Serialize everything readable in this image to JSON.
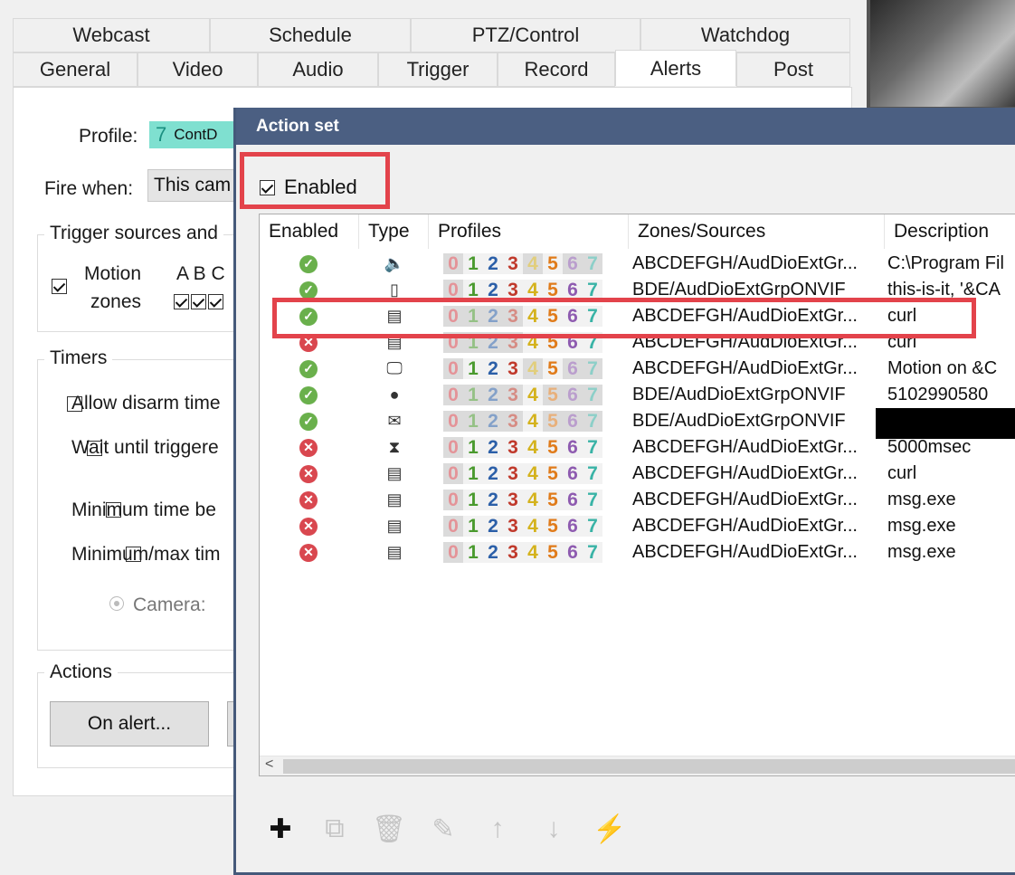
{
  "tabs_row1": [
    "Webcast",
    "Schedule",
    "PTZ/Control",
    "Watchdog"
  ],
  "tabs_row2": [
    "General",
    "Video",
    "Audio",
    "Trigger",
    "Record",
    "Alerts",
    "Post"
  ],
  "alerts_panel": {
    "profile_label": "Profile:",
    "profile_value_num": "7",
    "profile_value_text": "ContD",
    "fire_when_label": "Fire when:",
    "fire_when_value": "This cam",
    "trigger_group": "Trigger sources and",
    "motion_label_1": "Motion",
    "motion_label_2": "zones",
    "zone_letters": "A B C",
    "timers_group": "Timers",
    "allow_disarm": "Allow disarm time",
    "wait_until": "Wait until triggere",
    "minimum_time": "Minimum time be",
    "minmax_time": "Minimum/max tim",
    "camera_radio": "Camera:",
    "actions_group": "Actions",
    "on_alert_button": "On alert..."
  },
  "action_set": {
    "title": "Action set",
    "enabled_label": "Enabled",
    "enabled_checked": true,
    "columns": [
      "Enabled",
      "Type",
      "Profiles",
      "Zones/Sources",
      "Description"
    ],
    "profile_digits": [
      "0",
      "1",
      "2",
      "3",
      "4",
      "5",
      "6",
      "7"
    ],
    "profile_colors": [
      "#d9474f",
      "#4a9a2e",
      "#2b5fa8",
      "#c0392b",
      "#d4b21c",
      "#e07b1a",
      "#8e5bb0",
      "#39b3a6"
    ],
    "rows": [
      {
        "enabled": true,
        "type_icon": "speaker-icon",
        "type_glyph": "🔈",
        "profiles_on": [
          1,
          2,
          3,
          5
        ],
        "zones": "ABCDEFGH/AudDioExtGr...",
        "description": "C:\\Program Fil"
      },
      {
        "enabled": true,
        "type_icon": "phone-icon",
        "type_glyph": "▯",
        "profiles_on": [
          1,
          2,
          3,
          4,
          5,
          6,
          7
        ],
        "zones": "BDE/AudDioExtGrpONVIF",
        "description": "this-is-it, '&CA"
      },
      {
        "enabled": true,
        "type_icon": "document-icon",
        "type_glyph": "▤",
        "profiles_on": [
          4,
          5,
          6,
          7
        ],
        "zones": "ABCDEFGH/AudDioExtGr...",
        "description": "curl"
      },
      {
        "enabled": false,
        "type_icon": "document-icon",
        "type_glyph": "▤",
        "profiles_on": [
          4,
          5,
          6,
          7
        ],
        "zones": "ABCDEFGH/AudDioExtGr...",
        "description": "curl"
      },
      {
        "enabled": true,
        "type_icon": "monitor-icon",
        "type_glyph": "🖵",
        "profiles_on": [
          1,
          2,
          3,
          5
        ],
        "zones": "ABCDEFGH/AudDioExtGr...",
        "description": "Motion on &C"
      },
      {
        "enabled": true,
        "type_icon": "speech-bubble-icon",
        "type_glyph": "●",
        "profiles_on": [
          4
        ],
        "zones": "BDE/AudDioExtGrpONVIF",
        "description": "5102990580"
      },
      {
        "enabled": true,
        "type_icon": "envelope-icon",
        "type_glyph": "✉",
        "profiles_on": [
          4
        ],
        "zones": "BDE/AudDioExtGrpONVIF",
        "description": ""
      },
      {
        "enabled": false,
        "type_icon": "hourglass-icon",
        "type_glyph": "⧗",
        "profiles_on": [
          1,
          2,
          3,
          4,
          5,
          6,
          7
        ],
        "zones": "ABCDEFGH/AudDioExtGr...",
        "description": "5000msec"
      },
      {
        "enabled": false,
        "type_icon": "document-icon",
        "type_glyph": "▤",
        "profiles_on": [
          1,
          2,
          3,
          4,
          5,
          6,
          7
        ],
        "zones": "ABCDEFGH/AudDioExtGr...",
        "description": "curl"
      },
      {
        "enabled": false,
        "type_icon": "document-icon",
        "type_glyph": "▤",
        "profiles_on": [
          1,
          2,
          3,
          4,
          5,
          6,
          7
        ],
        "zones": "ABCDEFGH/AudDioExtGr...",
        "description": "msg.exe"
      },
      {
        "enabled": false,
        "type_icon": "document-icon",
        "type_glyph": "▤",
        "profiles_on": [
          1,
          2,
          3,
          4,
          5,
          6,
          7
        ],
        "zones": "ABCDEFGH/AudDioExtGr...",
        "description": "msg.exe"
      },
      {
        "enabled": false,
        "type_icon": "document-icon",
        "type_glyph": "▤",
        "profiles_on": [
          1,
          2,
          3,
          4,
          5,
          6,
          7
        ],
        "zones": "ABCDEFGH/AudDioExtGr...",
        "description": "msg.exe"
      }
    ],
    "scroll_left_glyph": "<",
    "toolbar": [
      {
        "name": "add-icon",
        "glyph": "✚",
        "enabled": true
      },
      {
        "name": "copy-icon",
        "glyph": "⧉",
        "enabled": false
      },
      {
        "name": "delete-icon",
        "glyph": "🗑",
        "enabled": false
      },
      {
        "name": "edit-icon",
        "glyph": "✎",
        "enabled": false
      },
      {
        "name": "move-up-icon",
        "glyph": "↑",
        "enabled": false
      },
      {
        "name": "move-down-icon",
        "glyph": "↓",
        "enabled": false
      },
      {
        "name": "test-fire-icon",
        "glyph": "⚡",
        "enabled": true
      }
    ]
  },
  "colors": {
    "title_bar": "#4b5f82",
    "highlight_red": "#e3434b",
    "ok_green": "#6ab04c",
    "error_red": "#d9474f"
  }
}
